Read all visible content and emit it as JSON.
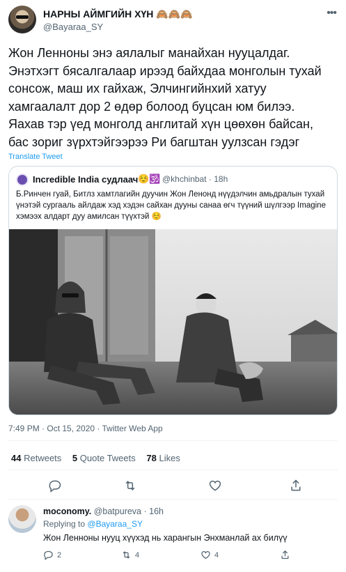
{
  "tweet": {
    "display_name": "НАРНЫ АЙМГИЙН ХҮН 🙈🙈🙈",
    "handle": "@Bayaraa_SY",
    "text_lines": [
      "Жон Ленноны энэ аялалыг манайхан нууцалдаг.",
      "Энэтхэгт бясалгалаар ирээд байхдаа монголын тухай",
      "сонсож, маш их гайхаж, Элчингийнхий хатуу",
      "хамгаалалт дор 2 өдөр болоод буцсан юм билээ.",
      "Яахав тэр үед монголд англитай хүн цөөхөн байсан,",
      "бас зориг зүрхтэйгээрээ Ри багштан уулзсан гэдэг"
    ],
    "translate_label": "Translate Tweet",
    "meta": "7:49 PM · Oct 15, 2020 · Twitter Web App",
    "stats": {
      "retweets_count": "44",
      "retweets_label": "Retweets",
      "quotes_count": "5",
      "quotes_label": "Quote Tweets",
      "likes_count": "78",
      "likes_label": "Likes"
    }
  },
  "quote": {
    "name": "Incredible India судлаач",
    "emoji": "☺️🕉️",
    "handle_time": "@khchinbat · 18h",
    "text": "Б.Ринчен гуай, Битлз хамтлагийн дуучин Жон Ленонд нүүдэлчин амьдралын тухай үнэтэй сургааль айлдаж хэд хэдэн сайхан дууны санаа өгч түүний шүлгээр Imagine хэмээх алдарт дуу амилсан түүхтэй ☺️"
  },
  "reply": {
    "name": "moconomy.",
    "handle_time": "@batpureva · 16h",
    "replying_prefix": "Replying to",
    "replying_to": "@Bayaraa_SY",
    "text": "Жон Ленноны нууц хүүхэд нь харангын Энхманлай ах билүү",
    "replies": "2",
    "retweets": "4",
    "likes": "4"
  },
  "colors": {
    "accent": "#1d9bf0",
    "muted": "#536471",
    "border": "#cfd9de"
  },
  "icons": [
    "more-icon",
    "reply-icon",
    "retweet-icon",
    "like-icon",
    "share-icon"
  ]
}
